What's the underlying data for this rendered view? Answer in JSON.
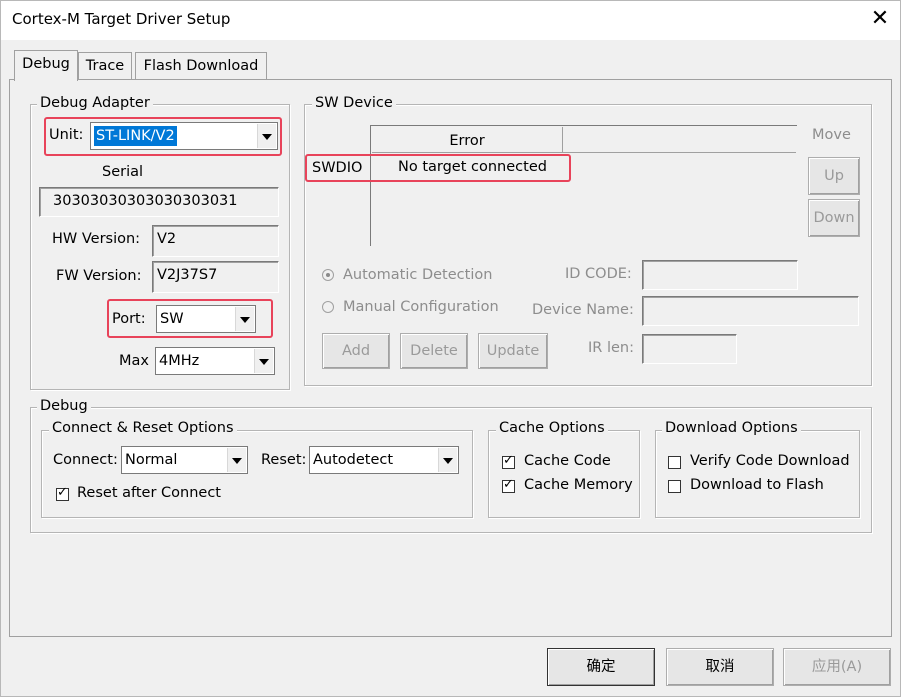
{
  "window": {
    "title": "Cortex-M Target Driver Setup",
    "close_glyph": "✕"
  },
  "tabs": [
    {
      "label": "Debug"
    },
    {
      "label": "Trace"
    },
    {
      "label": "Flash Download"
    }
  ],
  "debug_adapter": {
    "group_label": "Debug Adapter",
    "unit_label": "Unit:",
    "unit_value": "ST-LINK/V2",
    "serial_label": "Serial",
    "serial_value": "30303030303030303031",
    "hw_label": "HW Version:",
    "hw_value": "V2",
    "fw_label": "FW Version:",
    "fw_value": "V2J37S7",
    "port_label": "Port:",
    "port_value": "SW",
    "max_label": "Max",
    "max_value": "4MHz"
  },
  "sw_device": {
    "group_label": "SW Device",
    "column_header": "Error",
    "row_label": "SWDIO",
    "row_value": "No target connected",
    "move_label": "Move",
    "up_label": "Up",
    "down_label": "Down",
    "auto_detection_label": "Automatic Detection",
    "manual_config_label": "Manual Configuration",
    "id_code_label": "ID CODE:",
    "device_name_label": "Device Name:",
    "ir_len_label": "IR len:",
    "add_label": "Add",
    "delete_label": "Delete",
    "update_label": "Update"
  },
  "debug_section": {
    "group_label": "Debug",
    "connect_reset": {
      "group_label": "Connect & Reset Options",
      "connect_label": "Connect:",
      "connect_value": "Normal",
      "reset_label": "Reset:",
      "reset_value": "Autodetect",
      "reset_after_connect_label": "Reset after Connect",
      "reset_after_connect_checked": true
    },
    "cache": {
      "group_label": "Cache Options",
      "cache_code_label": "Cache Code",
      "cache_code_checked": true,
      "cache_memory_label": "Cache Memory",
      "cache_memory_checked": true
    },
    "download": {
      "group_label": "Download Options",
      "verify_label": "Verify Code Download",
      "verify_checked": false,
      "download_flash_label": "Download to Flash",
      "download_flash_checked": false
    }
  },
  "footer": {
    "ok_label": "确定",
    "cancel_label": "取消",
    "apply_label": "应用(A)"
  },
  "colors": {
    "highlight_box": "#e8435a",
    "selection": "#0078d7"
  }
}
